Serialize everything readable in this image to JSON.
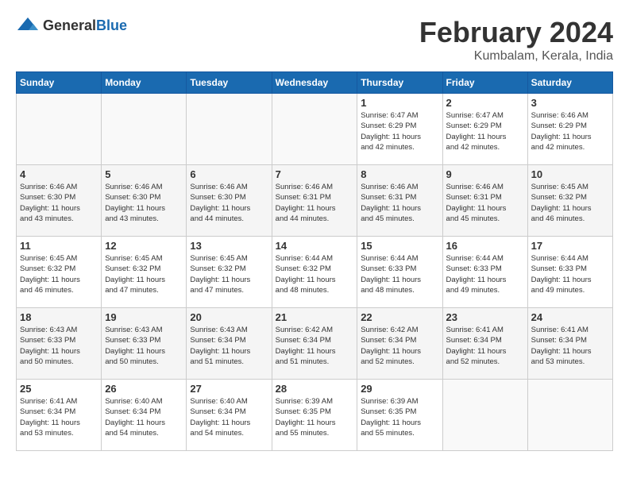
{
  "header": {
    "logo": {
      "text_general": "General",
      "text_blue": "Blue"
    },
    "title": "February 2024",
    "location": "Kumbalam, Kerala, India"
  },
  "weekdays": [
    "Sunday",
    "Monday",
    "Tuesday",
    "Wednesday",
    "Thursday",
    "Friday",
    "Saturday"
  ],
  "weeks": [
    [
      {
        "day": "",
        "info": ""
      },
      {
        "day": "",
        "info": ""
      },
      {
        "day": "",
        "info": ""
      },
      {
        "day": "",
        "info": ""
      },
      {
        "day": "1",
        "info": "Sunrise: 6:47 AM\nSunset: 6:29 PM\nDaylight: 11 hours\nand 42 minutes."
      },
      {
        "day": "2",
        "info": "Sunrise: 6:47 AM\nSunset: 6:29 PM\nDaylight: 11 hours\nand 42 minutes."
      },
      {
        "day": "3",
        "info": "Sunrise: 6:46 AM\nSunset: 6:29 PM\nDaylight: 11 hours\nand 42 minutes."
      }
    ],
    [
      {
        "day": "4",
        "info": "Sunrise: 6:46 AM\nSunset: 6:30 PM\nDaylight: 11 hours\nand 43 minutes."
      },
      {
        "day": "5",
        "info": "Sunrise: 6:46 AM\nSunset: 6:30 PM\nDaylight: 11 hours\nand 43 minutes."
      },
      {
        "day": "6",
        "info": "Sunrise: 6:46 AM\nSunset: 6:30 PM\nDaylight: 11 hours\nand 44 minutes."
      },
      {
        "day": "7",
        "info": "Sunrise: 6:46 AM\nSunset: 6:31 PM\nDaylight: 11 hours\nand 44 minutes."
      },
      {
        "day": "8",
        "info": "Sunrise: 6:46 AM\nSunset: 6:31 PM\nDaylight: 11 hours\nand 45 minutes."
      },
      {
        "day": "9",
        "info": "Sunrise: 6:46 AM\nSunset: 6:31 PM\nDaylight: 11 hours\nand 45 minutes."
      },
      {
        "day": "10",
        "info": "Sunrise: 6:45 AM\nSunset: 6:32 PM\nDaylight: 11 hours\nand 46 minutes."
      }
    ],
    [
      {
        "day": "11",
        "info": "Sunrise: 6:45 AM\nSunset: 6:32 PM\nDaylight: 11 hours\nand 46 minutes."
      },
      {
        "day": "12",
        "info": "Sunrise: 6:45 AM\nSunset: 6:32 PM\nDaylight: 11 hours\nand 47 minutes."
      },
      {
        "day": "13",
        "info": "Sunrise: 6:45 AM\nSunset: 6:32 PM\nDaylight: 11 hours\nand 47 minutes."
      },
      {
        "day": "14",
        "info": "Sunrise: 6:44 AM\nSunset: 6:32 PM\nDaylight: 11 hours\nand 48 minutes."
      },
      {
        "day": "15",
        "info": "Sunrise: 6:44 AM\nSunset: 6:33 PM\nDaylight: 11 hours\nand 48 minutes."
      },
      {
        "day": "16",
        "info": "Sunrise: 6:44 AM\nSunset: 6:33 PM\nDaylight: 11 hours\nand 49 minutes."
      },
      {
        "day": "17",
        "info": "Sunrise: 6:44 AM\nSunset: 6:33 PM\nDaylight: 11 hours\nand 49 minutes."
      }
    ],
    [
      {
        "day": "18",
        "info": "Sunrise: 6:43 AM\nSunset: 6:33 PM\nDaylight: 11 hours\nand 50 minutes."
      },
      {
        "day": "19",
        "info": "Sunrise: 6:43 AM\nSunset: 6:33 PM\nDaylight: 11 hours\nand 50 minutes."
      },
      {
        "day": "20",
        "info": "Sunrise: 6:43 AM\nSunset: 6:34 PM\nDaylight: 11 hours\nand 51 minutes."
      },
      {
        "day": "21",
        "info": "Sunrise: 6:42 AM\nSunset: 6:34 PM\nDaylight: 11 hours\nand 51 minutes."
      },
      {
        "day": "22",
        "info": "Sunrise: 6:42 AM\nSunset: 6:34 PM\nDaylight: 11 hours\nand 52 minutes."
      },
      {
        "day": "23",
        "info": "Sunrise: 6:41 AM\nSunset: 6:34 PM\nDaylight: 11 hours\nand 52 minutes."
      },
      {
        "day": "24",
        "info": "Sunrise: 6:41 AM\nSunset: 6:34 PM\nDaylight: 11 hours\nand 53 minutes."
      }
    ],
    [
      {
        "day": "25",
        "info": "Sunrise: 6:41 AM\nSunset: 6:34 PM\nDaylight: 11 hours\nand 53 minutes."
      },
      {
        "day": "26",
        "info": "Sunrise: 6:40 AM\nSunset: 6:34 PM\nDaylight: 11 hours\nand 54 minutes."
      },
      {
        "day": "27",
        "info": "Sunrise: 6:40 AM\nSunset: 6:34 PM\nDaylight: 11 hours\nand 54 minutes."
      },
      {
        "day": "28",
        "info": "Sunrise: 6:39 AM\nSunset: 6:35 PM\nDaylight: 11 hours\nand 55 minutes."
      },
      {
        "day": "29",
        "info": "Sunrise: 6:39 AM\nSunset: 6:35 PM\nDaylight: 11 hours\nand 55 minutes."
      },
      {
        "day": "",
        "info": ""
      },
      {
        "day": "",
        "info": ""
      }
    ]
  ]
}
